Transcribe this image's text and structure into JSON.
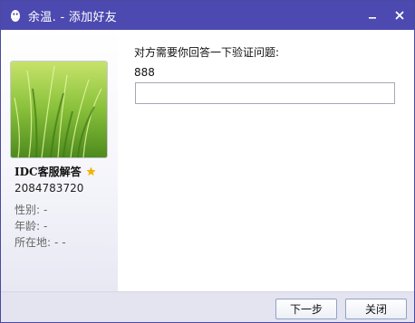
{
  "window": {
    "title": "余温. - 添加好友",
    "icons": {
      "app": "qq-penguin-icon",
      "minimize": "minimize-icon",
      "close": "close-icon"
    }
  },
  "profile": {
    "avatar": "green-grass-photo",
    "name": "IDC客服解答",
    "star_icon": "star-icon",
    "star_color": "#f2b400",
    "qq_number": "2084783720",
    "gender_label": "性别:",
    "gender_value": "-",
    "age_label": "年龄:",
    "age_value": "-",
    "location_label": "所在地:",
    "location_value1": "-",
    "location_value2": "-"
  },
  "verify": {
    "question_label": "对方需要你回答一下验证问题:",
    "question_hint": "888",
    "answer_value": ""
  },
  "footer": {
    "next_label": "下一步",
    "close_label": "关闭"
  },
  "colors": {
    "titlebar": "#4c4ab0",
    "footer": "#e4e3f0"
  }
}
